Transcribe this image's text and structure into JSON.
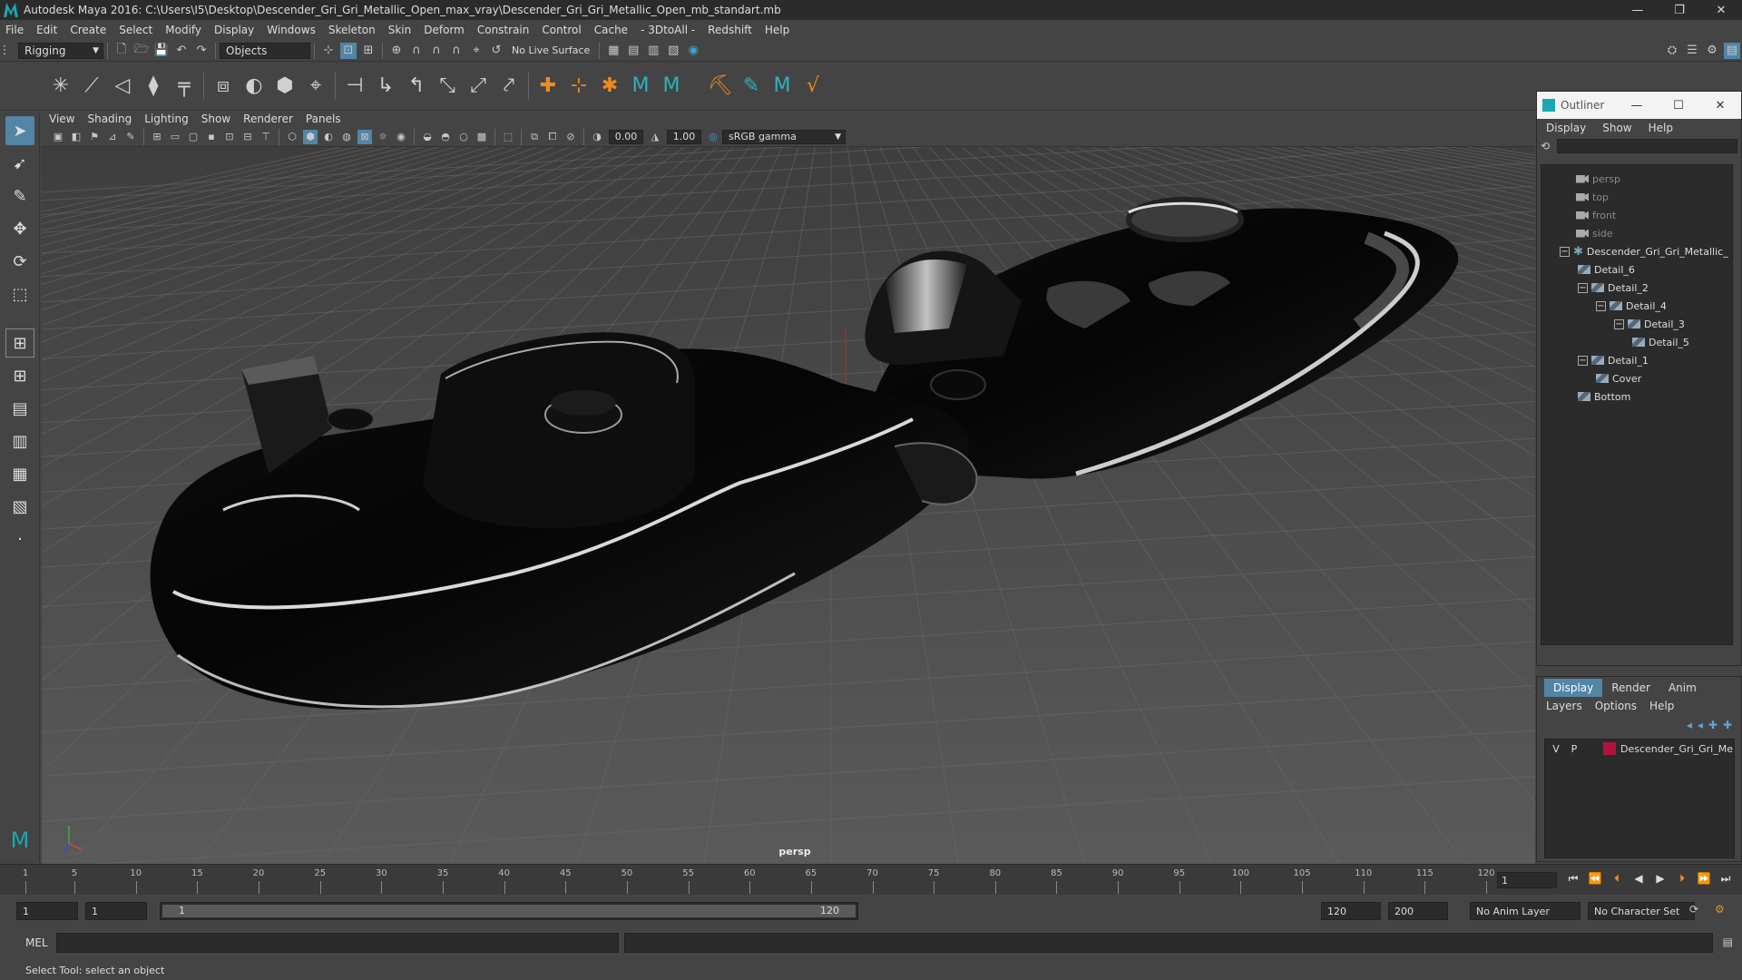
{
  "window": {
    "title": "Autodesk Maya 2016: C:\\Users\\I5\\Desktop\\Descender_Gri_Gri_Metallic_Open_max_vray\\Descender_Gri_Gri_Metallic_Open_mb_standart.mb",
    "minimize": "—",
    "restore": "❐",
    "close": "✕"
  },
  "menubar": [
    "File",
    "Edit",
    "Create",
    "Select",
    "Modify",
    "Display",
    "Windows",
    "Skeleton",
    "Skin",
    "Deform",
    "Constrain",
    "Control",
    "Cache",
    "- 3DtoAll -",
    "Redshift",
    "Help"
  ],
  "statusline": {
    "menuset": "Rigging",
    "selmode": "Objects",
    "live_surface": "No Live Surface"
  },
  "viewport": {
    "menu": [
      "View",
      "Shading",
      "Lighting",
      "Show",
      "Renderer",
      "Panels"
    ],
    "exposure": "0.00",
    "gamma": "1.00",
    "colorspace": "sRGB gamma",
    "camera_label": "persp"
  },
  "outliner": {
    "title": "Outliner",
    "menu": [
      "Display",
      "Show",
      "Help"
    ],
    "items": [
      {
        "label": "persp",
        "kind": "camera",
        "depth": 0
      },
      {
        "label": "top",
        "kind": "camera",
        "depth": 0
      },
      {
        "label": "front",
        "kind": "camera",
        "depth": 0
      },
      {
        "label": "side",
        "kind": "camera",
        "depth": 0
      },
      {
        "label": "Descender_Gri_Gri_Metallic_",
        "kind": "group",
        "depth": 0,
        "toggle": "−"
      },
      {
        "label": "Detail_6",
        "kind": "mesh",
        "depth": 1
      },
      {
        "label": "Detail_2",
        "kind": "mesh",
        "depth": 1,
        "toggle": "−"
      },
      {
        "label": "Detail_4",
        "kind": "mesh",
        "depth": 2,
        "toggle": "−"
      },
      {
        "label": "Detail_3",
        "kind": "mesh",
        "depth": 3,
        "toggle": "−"
      },
      {
        "label": "Detail_5",
        "kind": "mesh",
        "depth": 4
      },
      {
        "label": "Detail_1",
        "kind": "mesh",
        "depth": 1,
        "toggle": "−"
      },
      {
        "label": "Cover",
        "kind": "mesh",
        "depth": 2
      },
      {
        "label": "Bottom",
        "kind": "mesh",
        "depth": 1
      }
    ]
  },
  "layers": {
    "tabs": [
      "Display",
      "Render",
      "Anim"
    ],
    "active_tab": "Display",
    "menu": [
      "Layers",
      "Options",
      "Help"
    ],
    "rows": [
      {
        "v": "V",
        "p": "P",
        "name": "Descender_Gri_Gri_Me",
        "color": "#b0143c"
      }
    ]
  },
  "timeline": {
    "ticks": [
      1,
      5,
      10,
      15,
      20,
      25,
      30,
      35,
      40,
      45,
      50,
      55,
      60,
      65,
      70,
      75,
      80,
      85,
      90,
      95,
      100,
      105,
      110,
      115,
      120
    ],
    "current_frame": "1"
  },
  "range": {
    "start": "1",
    "playback_start": "1",
    "range_start_label": "1",
    "range_end_label": "120",
    "playback_end": "120",
    "end": "200",
    "anim_layer": "No Anim Layer",
    "char_set": "No Character Set"
  },
  "cmdline": {
    "label": "MEL"
  },
  "helpline": {
    "text": "Select Tool: select an object"
  }
}
